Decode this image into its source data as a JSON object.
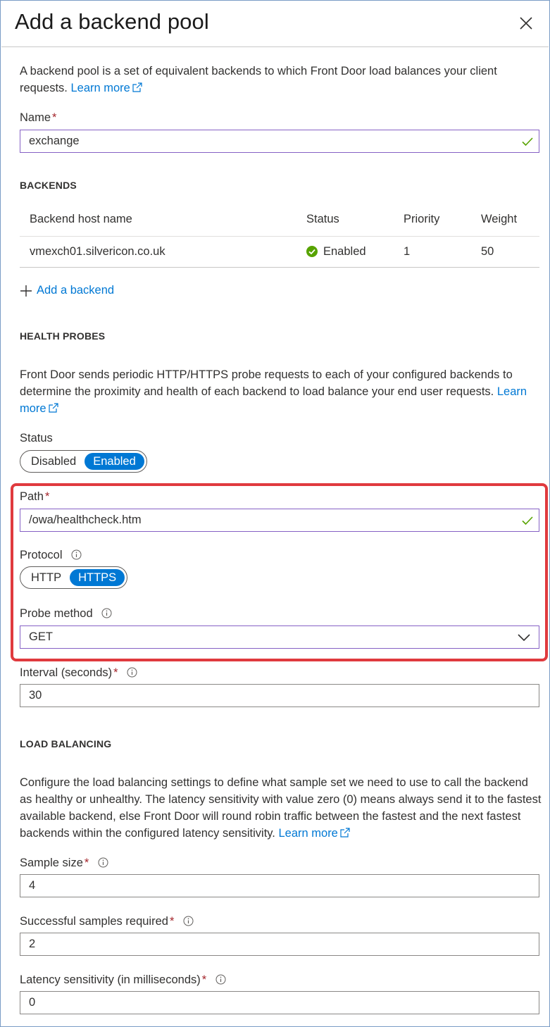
{
  "header": {
    "title": "Add a backend pool",
    "close_icon": "close-icon"
  },
  "intro": {
    "text": "A backend pool is a set of equivalent backends to which Front Door load balances your client requests.",
    "learn_more": "Learn more"
  },
  "name_field": {
    "label": "Name",
    "required": "*",
    "value": "exchange"
  },
  "backends": {
    "section_title": "BACKENDS",
    "columns": [
      "Backend host name",
      "Status",
      "Priority",
      "Weight"
    ],
    "rows": [
      {
        "host": "vmexch01.silvericon.co.uk",
        "status": "Enabled",
        "priority": "1",
        "weight": "50"
      }
    ],
    "add_label": "Add a backend"
  },
  "health_probes": {
    "section_title": "HEALTH PROBES",
    "text": "Front Door sends periodic HTTP/HTTPS probe requests to each of your configured backends to determine the proximity and health of each backend to load balance your end user requests.",
    "learn_more": "Learn more",
    "status": {
      "label": "Status",
      "options": [
        "Disabled",
        "Enabled"
      ],
      "selected": "Enabled"
    },
    "path": {
      "label": "Path",
      "required": "*",
      "value": "/owa/healthcheck.htm"
    },
    "protocol": {
      "label": "Protocol",
      "options": [
        "HTTP",
        "HTTPS"
      ],
      "selected": "HTTPS"
    },
    "probe_method": {
      "label": "Probe method",
      "value": "GET"
    },
    "interval": {
      "label": "Interval (seconds)",
      "required": "*",
      "value": "30"
    }
  },
  "load_balancing": {
    "section_title": "LOAD BALANCING",
    "text": "Configure the load balancing settings to define what sample set we need to use to call the backend as healthy or unhealthy. The latency sensitivity with value zero (0) means always send it to the fastest available backend, else Front Door will round robin traffic between the fastest and the next fastest backends within the configured latency sensitivity.",
    "learn_more": "Learn more",
    "sample_size": {
      "label": "Sample size",
      "required": "*",
      "value": "4"
    },
    "successful_samples": {
      "label": "Successful samples required",
      "required": "*",
      "value": "2"
    },
    "latency": {
      "label": "Latency sensitivity (in milliseconds)",
      "required": "*",
      "value": "0"
    }
  },
  "colors": {
    "accent": "#0078d4",
    "highlight": "#e03a3e",
    "valid_border": "#8661c5",
    "success": "#57a300",
    "required": "#a4262c"
  }
}
